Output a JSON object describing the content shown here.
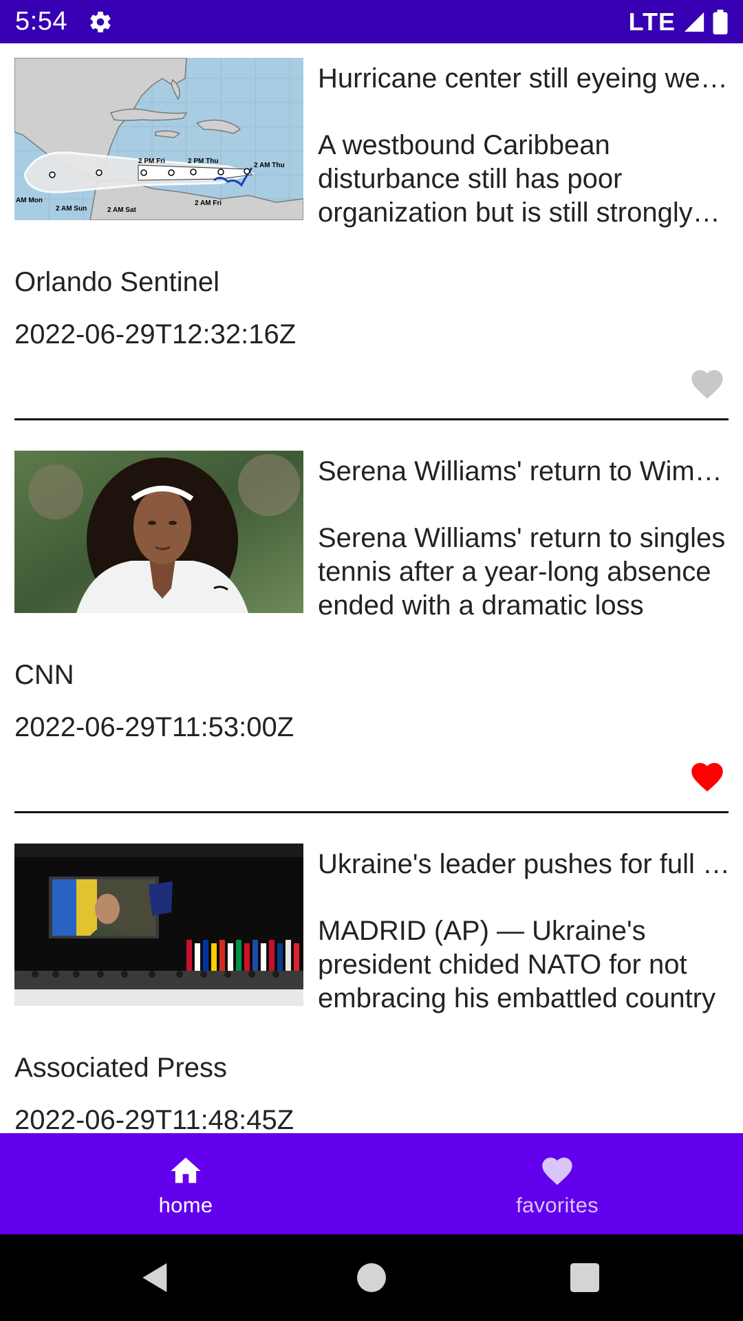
{
  "status_bar": {
    "time": "5:54",
    "network": "LTE"
  },
  "articles": [
    {
      "headline": "Hurricane center still eyeing westbound Caribbean disturbance",
      "summary": "A westbound Caribbean disturbance still has poor organization but is still strongly expected to develop",
      "source": "Orlando Sentinel",
      "date": "2022-06-29T12:32:16Z",
      "favorited": false,
      "map_labels": {
        "pm_fri": "2 PM Fri",
        "pm_thu": "2 PM Thu",
        "am_thu": "2 AM Thu",
        "am_mon": "AM Mon",
        "am_sun": "2 AM Sun",
        "am_sat": "2 AM Sat",
        "am_fri": "2 AM Fri"
      }
    },
    {
      "headline": "Serena Williams' return to Wimbledon",
      "summary": "Serena Williams' return to singles tennis after a year-long absence ended with a dramatic loss",
      "source": "CNN",
      "date": "2022-06-29T11:53:00Z",
      "favorited": true
    },
    {
      "headline": "Ukraine's leader pushes for full support from NATO",
      "summary": "MADRID (AP) — Ukraine's president chided NATO for not embracing his embattled country",
      "source": "Associated Press",
      "date": "2022-06-29T11:48:45Z",
      "favorited": false
    }
  ],
  "bottom_nav": {
    "items": [
      {
        "label": "home",
        "icon": "home-icon",
        "active": true
      },
      {
        "label": "favorites",
        "icon": "heart-icon",
        "active": false
      }
    ]
  },
  "colors": {
    "status_bar": "#3700b3",
    "bottom_nav": "#6200ee",
    "favorite_on": "#ff0000",
    "favorite_off": "#c8c8c8",
    "nav_inactive": "#d9c6f8"
  },
  "system_nav": [
    "back",
    "home",
    "recents"
  ]
}
